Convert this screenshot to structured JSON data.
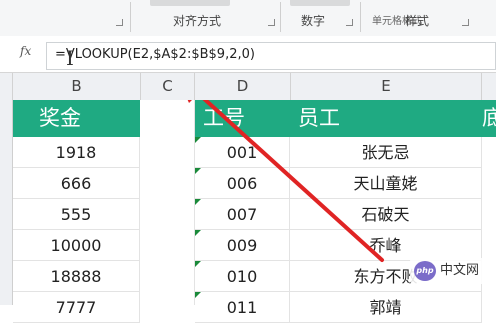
{
  "ribbon": {
    "group_alignment": "对齐方式",
    "group_number": "数字",
    "group_styles": "样式",
    "format_button_partial": "单元格格式"
  },
  "formula_bar": {
    "fx_label": "fx",
    "formula": "=VLOOKUP(E2,$A$2:$B$9,2,0)"
  },
  "columns": [
    "B",
    "C",
    "D",
    "E"
  ],
  "sheet": {
    "header_bonus": "奖金",
    "header_id": "工号",
    "header_employee": "员工",
    "header_last_partial": "底",
    "rows": [
      {
        "bonus": "1918",
        "id": "001",
        "name": "张无忌"
      },
      {
        "bonus": "666",
        "id": "006",
        "name": "天山童姥"
      },
      {
        "bonus": "555",
        "id": "007",
        "name": "石破天"
      },
      {
        "bonus": "10000",
        "id": "009",
        "name": "乔峰"
      },
      {
        "bonus": "18888",
        "id": "010",
        "name": "东方不败"
      },
      {
        "bonus": "7777",
        "id": "011",
        "name": "郭靖"
      }
    ]
  },
  "watermark": {
    "logo_text": "php",
    "text": "中文网"
  },
  "colors": {
    "header_green": "#1faa82",
    "arrow_red": "#e02424",
    "error_triangle": "#1a8a3a"
  }
}
